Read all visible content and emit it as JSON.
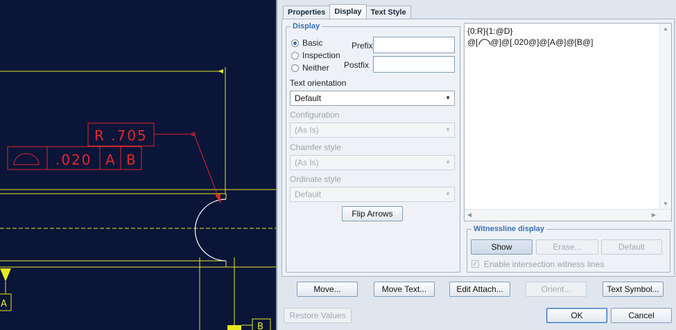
{
  "cad": {
    "radius_label": "R .705",
    "tolerance": ".020",
    "datum1": "A",
    "datum2": "B",
    "datum_tag_a": "A",
    "datum_tag_b": "B"
  },
  "dialog": {
    "tabs": [
      "Properties",
      "Display",
      "Text Style"
    ],
    "active_tab": "Display",
    "display_group": {
      "legend": "Display",
      "options": [
        "Basic",
        "Inspection",
        "Neither"
      ],
      "selected": "Basic",
      "prefix_label": "Prefix",
      "prefix_value": "",
      "postfix_label": "Postfix",
      "postfix_value": ""
    },
    "text_orientation": {
      "label": "Text orientation",
      "value": "Default"
    },
    "configuration": {
      "label": "Configuration",
      "value": "(As Is)"
    },
    "chamfer_style": {
      "label": "Chamfer style",
      "value": "(As Is)"
    },
    "ordinate_style": {
      "label": "Ordinate style",
      "value": "Default"
    },
    "flip_arrows": "Flip Arrows",
    "editor": {
      "line1": "{0:R}{1:@D}",
      "line2_pre": "@[",
      "line2_post": "@]@[.020@]@[A@]@[B@]"
    },
    "witness": {
      "legend": "Witnessline display",
      "show": "Show",
      "erase": "Erase...",
      "default": "Default",
      "checkbox_label": "Enable intersection witness lines"
    },
    "actions": [
      "Move...",
      "Move Text...",
      "Edit Attach...",
      "Orient...",
      "Text Symbol..."
    ],
    "restore": "Restore Values",
    "ok": "OK",
    "cancel": "Cancel"
  },
  "colors": {
    "cad_bg": "#0a1538",
    "geometry": "#e8e820",
    "annotation": "#e0282c",
    "white": "#ffffff"
  }
}
